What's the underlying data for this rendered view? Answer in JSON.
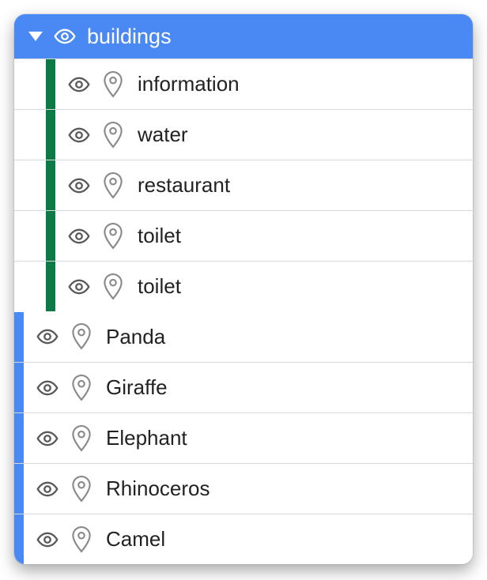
{
  "colors": {
    "headerBg": "#4A89F3",
    "childStrip": "#0B7A47",
    "rootStrip": "#4A89F3"
  },
  "header": {
    "label": "buildings"
  },
  "children": [
    {
      "label": "information"
    },
    {
      "label": "water"
    },
    {
      "label": "restaurant"
    },
    {
      "label": "toilet"
    },
    {
      "label": "toilet"
    }
  ],
  "items": [
    {
      "label": "Panda"
    },
    {
      "label": "Giraffe"
    },
    {
      "label": "Elephant"
    },
    {
      "label": "Rhinoceros"
    },
    {
      "label": "Camel"
    }
  ]
}
